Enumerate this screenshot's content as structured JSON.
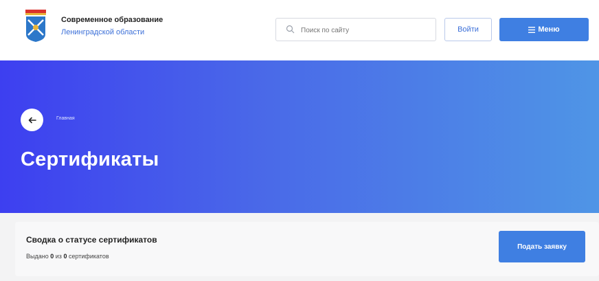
{
  "header": {
    "brand_title": "Современное образование",
    "brand_subtitle": "Ленинградской области",
    "search_placeholder": "Поиск по сайту",
    "login_label": "Войти",
    "menu_label": "Меню"
  },
  "hero": {
    "breadcrumb": "Главная",
    "title": "Сертификаты"
  },
  "summary": {
    "title": "Сводка о статусе сертификатов",
    "status_prefix": "Выдано",
    "issued": "0",
    "status_middle": "из",
    "total": "0",
    "status_suffix": "сертификатов",
    "apply_label": "Подать заявку"
  },
  "colors": {
    "accent": "#3f7fe2",
    "hero_start": "#3d3ff0",
    "hero_end": "#4f95e6"
  },
  "icons": {
    "logo": "region-coat-of-arms-icon",
    "search": "search-icon",
    "menu": "hamburger-icon",
    "back": "arrow-left-icon"
  }
}
